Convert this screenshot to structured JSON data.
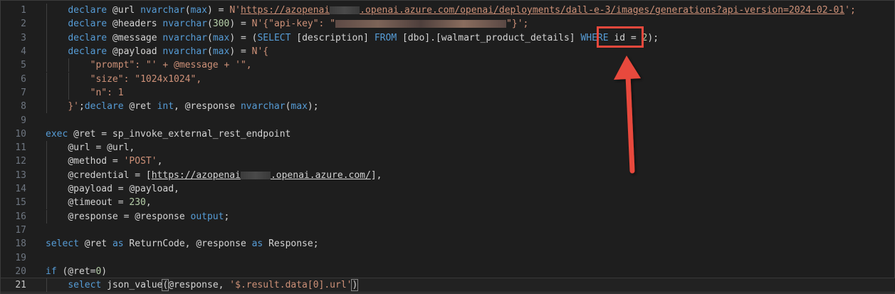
{
  "editor": {
    "lines": [
      {
        "n": "1",
        "indent": "    ",
        "tokens": [
          {
            "t": "declare",
            "c": "kw"
          },
          {
            "t": " @url ",
            "c": "plain"
          },
          {
            "t": "nvarchar",
            "c": "kw"
          },
          {
            "t": "(",
            "c": "plain"
          },
          {
            "t": "max",
            "c": "kw"
          },
          {
            "t": ") = ",
            "c": "plain"
          },
          {
            "t": "N'",
            "c": "str"
          },
          {
            "t": "https://azopenai",
            "c": "link"
          },
          {
            "t": "REDACT_G",
            "c": "redact-gray",
            "w": 42
          },
          {
            "t": ".openai.azure.com/openai/deployments/dall-e-3/images/generations?api-version=2024-02-01",
            "c": "link"
          },
          {
            "t": "';",
            "c": "str"
          }
        ]
      },
      {
        "n": "2",
        "indent": "    ",
        "tokens": [
          {
            "t": "declare",
            "c": "kw"
          },
          {
            "t": " @headers ",
            "c": "plain"
          },
          {
            "t": "nvarchar",
            "c": "kw"
          },
          {
            "t": "(",
            "c": "plain"
          },
          {
            "t": "300",
            "c": "num"
          },
          {
            "t": ") = ",
            "c": "plain"
          },
          {
            "t": "N'{\"api-key\": \"",
            "c": "str"
          },
          {
            "t": "REDACT",
            "c": "redact",
            "w": 240
          },
          {
            "t": "\"}';",
            "c": "str"
          }
        ]
      },
      {
        "n": "3",
        "indent": "    ",
        "tokens": [
          {
            "t": "declare",
            "c": "kw"
          },
          {
            "t": " @message ",
            "c": "plain"
          },
          {
            "t": "nvarchar",
            "c": "kw"
          },
          {
            "t": "(",
            "c": "plain"
          },
          {
            "t": "max",
            "c": "kw"
          },
          {
            "t": ") = (",
            "c": "plain"
          },
          {
            "t": "SELECT",
            "c": "kw"
          },
          {
            "t": " [description] ",
            "c": "plain"
          },
          {
            "t": "FROM",
            "c": "kw"
          },
          {
            "t": " [dbo].[walmart_product_details] ",
            "c": "plain"
          },
          {
            "t": "WHERE",
            "c": "kw"
          },
          {
            "t": " id = ",
            "c": "plain"
          },
          {
            "t": "2",
            "c": "num"
          },
          {
            "t": ");",
            "c": "plain"
          }
        ]
      },
      {
        "n": "4",
        "indent": "    ",
        "tokens": [
          {
            "t": "declare",
            "c": "kw"
          },
          {
            "t": " @payload ",
            "c": "plain"
          },
          {
            "t": "nvarchar",
            "c": "kw"
          },
          {
            "t": "(",
            "c": "plain"
          },
          {
            "t": "max",
            "c": "kw"
          },
          {
            "t": ") = ",
            "c": "plain"
          },
          {
            "t": "N'{",
            "c": "str"
          }
        ]
      },
      {
        "n": "5",
        "indent": "        ",
        "tokens": [
          {
            "t": "\"prompt\": \"' + @message + '\",",
            "c": "str"
          }
        ]
      },
      {
        "n": "6",
        "indent": "        ",
        "tokens": [
          {
            "t": "\"size\": \"1024x1024\",",
            "c": "str"
          }
        ]
      },
      {
        "n": "7",
        "indent": "        ",
        "tokens": [
          {
            "t": "\"n\": 1",
            "c": "str"
          }
        ]
      },
      {
        "n": "8",
        "indent": "    ",
        "tokens": [
          {
            "t": "}'",
            "c": "str"
          },
          {
            "t": ";",
            "c": "plain"
          },
          {
            "t": "declare",
            "c": "kw"
          },
          {
            "t": " @ret ",
            "c": "plain"
          },
          {
            "t": "int",
            "c": "kw"
          },
          {
            "t": ", @response ",
            "c": "plain"
          },
          {
            "t": "nvarchar",
            "c": "kw"
          },
          {
            "t": "(",
            "c": "plain"
          },
          {
            "t": "max",
            "c": "kw"
          },
          {
            "t": ");",
            "c": "plain"
          }
        ]
      },
      {
        "n": "9",
        "indent": "",
        "tokens": []
      },
      {
        "n": "10",
        "indent": "",
        "tokens": [
          {
            "t": "exec",
            "c": "kw"
          },
          {
            "t": " @ret = sp_invoke_external_rest_endpoint",
            "c": "plain"
          }
        ]
      },
      {
        "n": "11",
        "indent": "    ",
        "tokens": [
          {
            "t": "@url = @url,",
            "c": "plain"
          }
        ]
      },
      {
        "n": "12",
        "indent": "    ",
        "tokens": [
          {
            "t": "@method = ",
            "c": "plain"
          },
          {
            "t": "'POST'",
            "c": "str"
          },
          {
            "t": ",",
            "c": "plain"
          }
        ]
      },
      {
        "n": "13",
        "indent": "    ",
        "tokens": [
          {
            "t": "@credential = [",
            "c": "plain"
          },
          {
            "t": "https://azopenai",
            "c": "link-plain"
          },
          {
            "t": "REDACT_G",
            "c": "redact-gray",
            "w": 42
          },
          {
            "t": ".openai.azure.com/",
            "c": "link-plain"
          },
          {
            "t": "],",
            "c": "plain"
          }
        ]
      },
      {
        "n": "14",
        "indent": "    ",
        "tokens": [
          {
            "t": "@payload = @payload,",
            "c": "plain"
          }
        ]
      },
      {
        "n": "15",
        "indent": "    ",
        "tokens": [
          {
            "t": "@timeout = ",
            "c": "plain"
          },
          {
            "t": "230",
            "c": "num"
          },
          {
            "t": ",",
            "c": "plain"
          }
        ]
      },
      {
        "n": "16",
        "indent": "    ",
        "tokens": [
          {
            "t": "@response = @response ",
            "c": "plain"
          },
          {
            "t": "output",
            "c": "kw"
          },
          {
            "t": ";",
            "c": "plain"
          }
        ]
      },
      {
        "n": "17",
        "indent": "",
        "tokens": []
      },
      {
        "n": "18",
        "indent": "",
        "tokens": [
          {
            "t": "select",
            "c": "kw"
          },
          {
            "t": " @ret ",
            "c": "plain"
          },
          {
            "t": "as",
            "c": "kw"
          },
          {
            "t": " ReturnCode, @response ",
            "c": "plain"
          },
          {
            "t": "as",
            "c": "kw"
          },
          {
            "t": " Response;",
            "c": "plain"
          }
        ]
      },
      {
        "n": "19",
        "indent": "",
        "tokens": []
      },
      {
        "n": "20",
        "indent": "",
        "tokens": [
          {
            "t": "if",
            "c": "kw"
          },
          {
            "t": " (@ret=",
            "c": "plain"
          },
          {
            "t": "0",
            "c": "num"
          },
          {
            "t": ")",
            "c": "plain"
          }
        ]
      },
      {
        "n": "21",
        "indent": "    ",
        "tokens": [
          {
            "t": "select",
            "c": "kw"
          },
          {
            "t": " json_value",
            "c": "plain"
          },
          {
            "t": "(",
            "c": "bracket"
          },
          {
            "t": "@response, ",
            "c": "plain"
          },
          {
            "t": "'$.result.data[0].url'",
            "c": "str"
          },
          {
            "t": ")",
            "c": "bracket"
          }
        ]
      }
    ],
    "current_line": "21"
  },
  "colors": {
    "background": "#1e1e1e",
    "keyword": "#569cd6",
    "string": "#ce9178",
    "number": "#b5cea8",
    "annotation": "#e8483c"
  }
}
